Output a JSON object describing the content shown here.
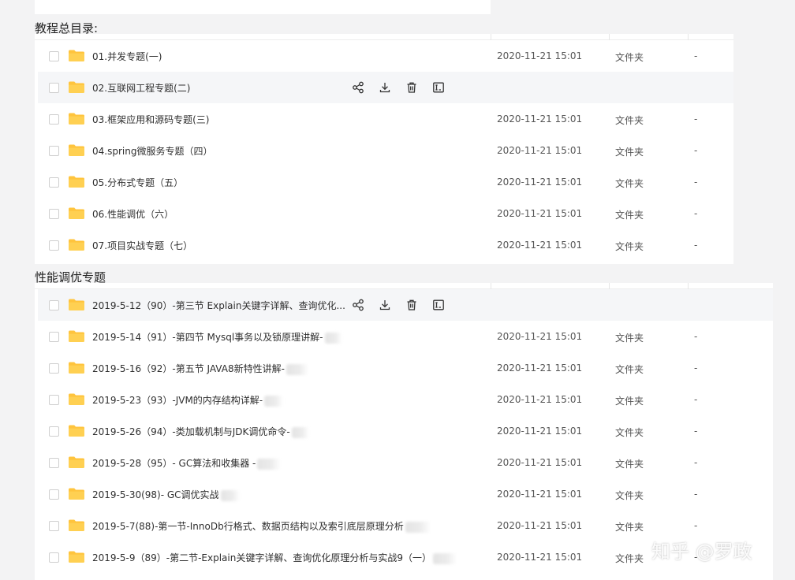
{
  "section1": {
    "title": "教程总目录:",
    "rows": [
      {
        "name": "01.并发专题(一)",
        "date": "2020-11-21 15:01",
        "type": "文件夹",
        "size": "-"
      },
      {
        "name": "02.互联网工程专题(二)",
        "date": "",
        "type": "",
        "size": ""
      },
      {
        "name": "03.框架应用和源码专题(三)",
        "date": "2020-11-21 15:01",
        "type": "文件夹",
        "size": "-"
      },
      {
        "name": "04.spring微服务专题（四）",
        "date": "2020-11-21 15:01",
        "type": "文件夹",
        "size": "-"
      },
      {
        "name": "05.分布式专题（五）",
        "date": "2020-11-21 15:01",
        "type": "文件夹",
        "size": "-"
      },
      {
        "name": "06.性能调优（六）",
        "date": "2020-11-21 15:01",
        "type": "文件夹",
        "size": "-"
      },
      {
        "name": "07.项目实战专题（七）",
        "date": "2020-11-21 15:01",
        "type": "文件夹",
        "size": "-"
      }
    ]
  },
  "section2": {
    "title": "性能调优专题",
    "rows": [
      {
        "name": "2019-5-12（90）-第三节 Explain关键字详解、查询优化...",
        "date": "",
        "type": "",
        "size": ""
      },
      {
        "name": "2019-5-14（91）-第四节 Mysql事务以及锁原理讲解-",
        "date": "2020-11-21 15:01",
        "type": "文件夹",
        "size": "-"
      },
      {
        "name": "2019-5-16（92）-第五节 JAVA8新特性讲解-",
        "date": "2020-11-21 15:01",
        "type": "文件夹",
        "size": "-"
      },
      {
        "name": "2019-5-23（93）-JVM的内存结构详解-",
        "date": "2020-11-21 15:01",
        "type": "文件夹",
        "size": "-"
      },
      {
        "name": "2019-5-26（94）-类加载机制与JDK调优命令-",
        "date": "2020-11-21 15:01",
        "type": "文件夹",
        "size": "-"
      },
      {
        "name": "2019-5-28（95）- GC算法和收集器 -",
        "date": "2020-11-21 15:01",
        "type": "文件夹",
        "size": "-"
      },
      {
        "name": "2019-5-30(98)- GC调优实战",
        "date": "2020-11-21 15:01",
        "type": "文件夹",
        "size": "-"
      },
      {
        "name": "2019-5-7(88)-第一节-InnoDb行格式、数据页结构以及索引底层原理分析",
        "date": "2020-11-21 15:01",
        "type": "文件夹",
        "size": "-"
      },
      {
        "name": "2019-5-9（89）-第二节-Explain关键字详解、查询优化原理分析与实战9（一）",
        "date": "2020-11-21 15:01",
        "type": "文件夹",
        "size": "-"
      }
    ]
  },
  "icons": {
    "folder": "folder-icon",
    "share": "share-icon",
    "download": "download-icon",
    "delete": "trash-icon",
    "rename": "rename-icon"
  },
  "colors": {
    "folder": "#ffc43d",
    "background": "#f3f3f4",
    "hover_row": "#f5f6f8"
  },
  "watermark": "知乎 @罗政"
}
